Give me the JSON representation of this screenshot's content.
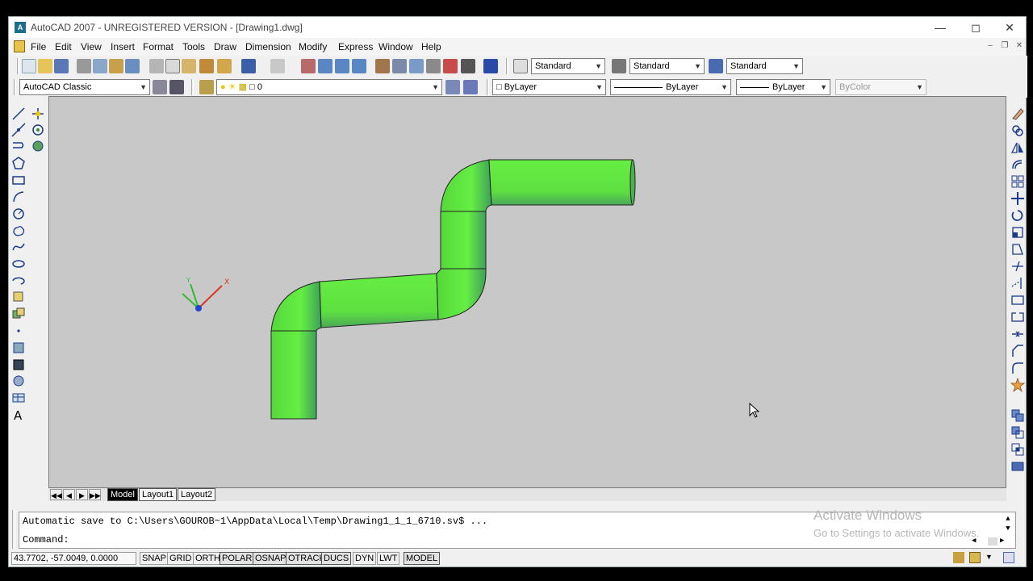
{
  "window": {
    "title": "AutoCAD 2007 - UNREGISTERED VERSION - [Drawing1.dwg]",
    "app_icon_text": "A"
  },
  "menu": [
    "File",
    "Edit",
    "View",
    "Insert",
    "Format",
    "Tools",
    "Draw",
    "Dimension",
    "Modify",
    "Express",
    "Window",
    "Help"
  ],
  "styles_toolbar": {
    "text_style": "Standard",
    "dim_style": "Standard",
    "table_style": "Standard"
  },
  "workspace": "AutoCAD Classic",
  "layer": "0",
  "properties": {
    "color": "ByLayer",
    "linetype": "ByLayer",
    "lineweight": "ByLayer",
    "plot_style": "ByColor"
  },
  "ucs": {
    "x_label": "X",
    "y_label": "Y"
  },
  "layout_tabs": [
    "Model",
    "Layout1",
    "Layout2"
  ],
  "command": {
    "history": "Automatic save to C:\\Users\\GOUROB~1\\AppData\\Local\\Temp\\Drawing1_1_1_6710.sv$ ...",
    "prompt": "Command:"
  },
  "watermark": {
    "line1": "Activate Windows",
    "line2": "Go to Settings to activate Windows."
  },
  "status": {
    "coordinates": "43.7702, -57.0049, 0.0000",
    "toggles": [
      {
        "label": "SNAP",
        "on": false
      },
      {
        "label": "GRID",
        "on": false
      },
      {
        "label": "ORTHO",
        "on": false
      },
      {
        "label": "POLAR",
        "on": true
      },
      {
        "label": "OSNAP",
        "on": true
      },
      {
        "label": "OTRACK",
        "on": true
      },
      {
        "label": "DUCS",
        "on": true
      },
      {
        "label": "DYN",
        "on": false
      },
      {
        "label": "LWT",
        "on": false
      },
      {
        "label": "MODEL",
        "on": true
      }
    ]
  },
  "colors": {
    "pipe": "#66ee44",
    "canvas": "#c8c8c8",
    "ucs_x": "#dd3322",
    "ucs_y": "#33bb33",
    "ucs_z": "#2244cc"
  }
}
